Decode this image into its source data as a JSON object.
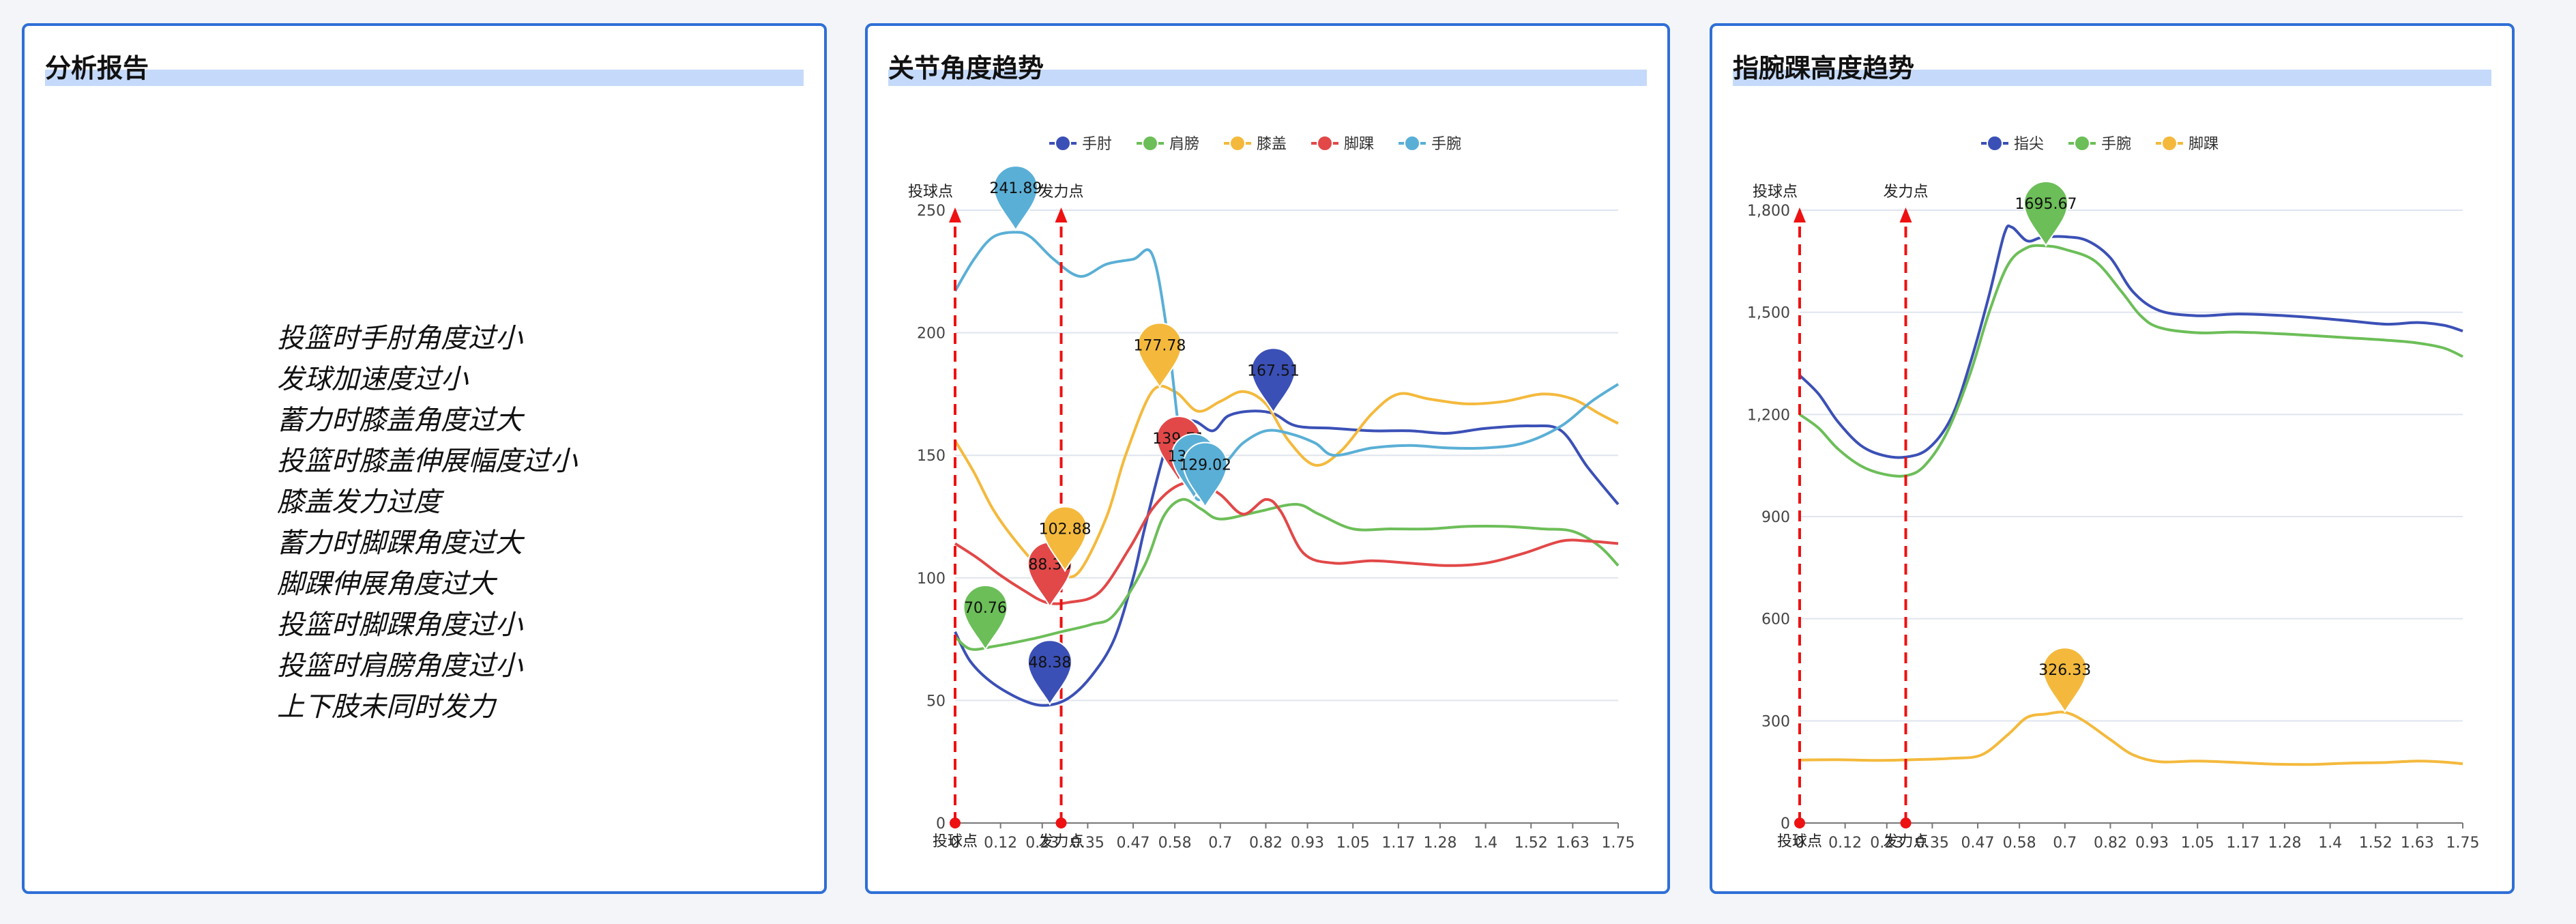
{
  "panels": {
    "report": {
      "title": "分析报告",
      "items": [
        "投篮时手肘角度过小",
        "发球加速度过小",
        "蓄力时膝盖角度过大",
        "投篮时膝盖伸展幅度过小",
        "膝盖发力过度",
        "蓄力时脚踝角度过大",
        "脚踝伸展角度过大",
        "投篮时脚踝角度过小",
        "投篮时肩膀角度过小",
        "上下肢未同时发力"
      ]
    },
    "joint": {
      "title": "关节角度趋势"
    },
    "height": {
      "title": "指腕踝高度趋势"
    }
  },
  "chart_data": [
    {
      "type": "line",
      "title": "关节角度趋势",
      "x": [
        0,
        0.12,
        0.23,
        0.35,
        0.47,
        0.58,
        0.7,
        0.82,
        0.93,
        1.05,
        1.17,
        1.28,
        1.4,
        1.52,
        1.63,
        1.75
      ],
      "x_tick_labels": [
        "0",
        "0.12",
        "0.23",
        "0.35",
        "0.47",
        "0.58",
        "0.7",
        "0.82",
        "0.93",
        "1.05",
        "1.17",
        "1.28",
        "1.4",
        "1.52",
        "1.63",
        "1.75"
      ],
      "xlim": [
        0,
        1.75
      ],
      "ylim": [
        0,
        250
      ],
      "y_ticks": [
        0,
        50,
        100,
        150,
        200,
        250
      ],
      "y_tick_labels": [
        "0",
        "50",
        "100",
        "150",
        "200",
        "250"
      ],
      "legend": "top-center",
      "grid": true,
      "series": [
        {
          "name": "手肘",
          "color": "#3b50b6",
          "points": [
            [
              0,
              78
            ],
            [
              0.04,
              66
            ],
            [
              0.1,
              57
            ],
            [
              0.18,
              50
            ],
            [
              0.24,
              48
            ],
            [
              0.3,
              51
            ],
            [
              0.36,
              60
            ],
            [
              0.42,
              75
            ],
            [
              0.47,
              100
            ],
            [
              0.5,
              120
            ],
            [
              0.55,
              150
            ],
            [
              0.58,
              162
            ],
            [
              0.63,
              164
            ],
            [
              0.68,
              160
            ],
            [
              0.72,
              166
            ],
            [
              0.78,
              168
            ],
            [
              0.84,
              167
            ],
            [
              0.9,
              162
            ],
            [
              1.0,
              161
            ],
            [
              1.1,
              160
            ],
            [
              1.2,
              160
            ],
            [
              1.3,
              159
            ],
            [
              1.4,
              161
            ],
            [
              1.52,
              162
            ],
            [
              1.6,
              160
            ],
            [
              1.67,
              145
            ],
            [
              1.75,
              130
            ]
          ]
        },
        {
          "name": "肩膀",
          "color": "#6cbe58",
          "points": [
            [
              0,
              76
            ],
            [
              0.04,
              71
            ],
            [
              0.1,
              72
            ],
            [
              0.2,
              75
            ],
            [
              0.28,
              78
            ],
            [
              0.36,
              81
            ],
            [
              0.42,
              85
            ],
            [
              0.5,
              105
            ],
            [
              0.55,
              125
            ],
            [
              0.6,
              132
            ],
            [
              0.65,
              128
            ],
            [
              0.7,
              124
            ],
            [
              0.8,
              127
            ],
            [
              0.9,
              130
            ],
            [
              0.96,
              126
            ],
            [
              1.05,
              120
            ],
            [
              1.15,
              120
            ],
            [
              1.25,
              120
            ],
            [
              1.35,
              121
            ],
            [
              1.45,
              121
            ],
            [
              1.55,
              120
            ],
            [
              1.63,
              119
            ],
            [
              1.7,
              113
            ],
            [
              1.75,
              105
            ]
          ]
        },
        {
          "name": "膝盖",
          "color": "#f4b93c",
          "points": [
            [
              0,
              156
            ],
            [
              0.05,
              143
            ],
            [
              0.1,
              128
            ],
            [
              0.16,
              115
            ],
            [
              0.22,
              105
            ],
            [
              0.28,
              101
            ],
            [
              0.33,
              103
            ],
            [
              0.4,
              125
            ],
            [
              0.45,
              150
            ],
            [
              0.52,
              176
            ],
            [
              0.58,
              176
            ],
            [
              0.64,
              168
            ],
            [
              0.7,
              172
            ],
            [
              0.76,
              176
            ],
            [
              0.82,
              171
            ],
            [
              0.88,
              156
            ],
            [
              0.95,
              146
            ],
            [
              1.02,
              152
            ],
            [
              1.1,
              167
            ],
            [
              1.17,
              175
            ],
            [
              1.25,
              173
            ],
            [
              1.35,
              171
            ],
            [
              1.45,
              172
            ],
            [
              1.55,
              175
            ],
            [
              1.63,
              173
            ],
            [
              1.7,
              167
            ],
            [
              1.75,
              163
            ]
          ]
        },
        {
          "name": "脚踝",
          "color": "#e24848",
          "points": [
            [
              0,
              114
            ],
            [
              0.06,
              108
            ],
            [
              0.12,
              101
            ],
            [
              0.18,
              95
            ],
            [
              0.24,
              90
            ],
            [
              0.3,
              90
            ],
            [
              0.38,
              94
            ],
            [
              0.46,
              112
            ],
            [
              0.52,
              128
            ],
            [
              0.58,
              137
            ],
            [
              0.64,
              139
            ],
            [
              0.7,
              134
            ],
            [
              0.76,
              126
            ],
            [
              0.82,
              132
            ],
            [
              0.86,
              127
            ],
            [
              0.92,
              110
            ],
            [
              1.0,
              106
            ],
            [
              1.1,
              107
            ],
            [
              1.2,
              106
            ],
            [
              1.3,
              105
            ],
            [
              1.4,
              106
            ],
            [
              1.5,
              110
            ],
            [
              1.6,
              115
            ],
            [
              1.67,
              115
            ],
            [
              1.75,
              114
            ]
          ]
        },
        {
          "name": "手腕",
          "color": "#5aafd6",
          "points": [
            [
              0,
              217
            ],
            [
              0.05,
              230
            ],
            [
              0.1,
              239
            ],
            [
              0.16,
              241
            ],
            [
              0.2,
              239
            ],
            [
              0.26,
              230
            ],
            [
              0.33,
              223
            ],
            [
              0.4,
              228
            ],
            [
              0.47,
              230
            ],
            [
              0.52,
              232
            ],
            [
              0.56,
              200
            ],
            [
              0.6,
              150
            ],
            [
              0.64,
              132
            ],
            [
              0.68,
              142
            ],
            [
              0.72,
              148
            ],
            [
              0.76,
              155
            ],
            [
              0.82,
              160
            ],
            [
              0.88,
              159
            ],
            [
              0.95,
              155
            ],
            [
              1.0,
              150
            ],
            [
              1.1,
              153
            ],
            [
              1.2,
              154
            ],
            [
              1.3,
              153
            ],
            [
              1.4,
              153
            ],
            [
              1.5,
              155
            ],
            [
              1.6,
              162
            ],
            [
              1.68,
              172
            ],
            [
              1.75,
              179
            ]
          ]
        }
      ],
      "pins": [
        {
          "series": 4,
          "x": 0.16,
          "y": 241.89,
          "label": "241.89"
        },
        {
          "series": 1,
          "x": 0.08,
          "y": 70.76,
          "label": "70.76"
        },
        {
          "series": 3,
          "x": 0.25,
          "y": 88.36,
          "label": "88.36"
        },
        {
          "series": 0,
          "x": 0.25,
          "y": 48.38,
          "label": "48.38"
        },
        {
          "series": 2,
          "x": 0.29,
          "y": 102.88,
          "label": "102.88"
        },
        {
          "series": 2,
          "x": 0.54,
          "y": 177.78,
          "label": "177.78"
        },
        {
          "series": 0,
          "x": 0.84,
          "y": 167.51,
          "label": "167.51"
        },
        {
          "series": 3,
          "x": 0.59,
          "y": 139.71,
          "label": "139.71"
        },
        {
          "series": 4,
          "x": 0.63,
          "y": 132.55,
          "label": "132.55"
        },
        {
          "series": 4,
          "x": 0.66,
          "y": 129.02,
          "label": "129.02"
        }
      ],
      "markers": [
        {
          "x": 0,
          "label": "投球点"
        },
        {
          "x": 0.28,
          "label": "发力点"
        }
      ]
    },
    {
      "type": "line",
      "title": "指腕踝高度趋势",
      "x": [
        0,
        0.12,
        0.23,
        0.35,
        0.47,
        0.58,
        0.7,
        0.82,
        0.93,
        1.05,
        1.17,
        1.28,
        1.4,
        1.52,
        1.63,
        1.75
      ],
      "x_tick_labels": [
        "0",
        "0.12",
        "0.23",
        "0.35",
        "0.47",
        "0.58",
        "0.7",
        "0.82",
        "0.93",
        "1.05",
        "1.17",
        "1.28",
        "1.4",
        "1.52",
        "1.63",
        "1.75"
      ],
      "xlim": [
        0,
        1.75
      ],
      "ylim": [
        0,
        1800
      ],
      "y_ticks": [
        0,
        300,
        600,
        900,
        1200,
        1500,
        1800
      ],
      "y_tick_labels": [
        "0",
        "300",
        "600",
        "900",
        "1,200",
        "1,500",
        "1,800"
      ],
      "legend": "top-center",
      "grid": true,
      "series": [
        {
          "name": "指尖",
          "color": "#3b50b6",
          "points": [
            [
              0,
              1315
            ],
            [
              0.05,
              1260
            ],
            [
              0.1,
              1180
            ],
            [
              0.16,
              1110
            ],
            [
              0.22,
              1080
            ],
            [
              0.28,
              1075
            ],
            [
              0.34,
              1100
            ],
            [
              0.4,
              1190
            ],
            [
              0.45,
              1350
            ],
            [
              0.5,
              1550
            ],
            [
              0.54,
              1730
            ],
            [
              0.56,
              1750
            ],
            [
              0.6,
              1710
            ],
            [
              0.64,
              1720
            ],
            [
              0.7,
              1722
            ],
            [
              0.76,
              1710
            ],
            [
              0.82,
              1660
            ],
            [
              0.88,
              1560
            ],
            [
              0.95,
              1505
            ],
            [
              1.05,
              1490
            ],
            [
              1.15,
              1495
            ],
            [
              1.25,
              1492
            ],
            [
              1.35,
              1485
            ],
            [
              1.45,
              1475
            ],
            [
              1.55,
              1465
            ],
            [
              1.63,
              1470
            ],
            [
              1.7,
              1462
            ],
            [
              1.75,
              1445
            ]
          ]
        },
        {
          "name": "手腕",
          "color": "#6cbe58",
          "points": [
            [
              0,
              1200
            ],
            [
              0.05,
              1160
            ],
            [
              0.1,
              1100
            ],
            [
              0.16,
              1050
            ],
            [
              0.22,
              1025
            ],
            [
              0.28,
              1020
            ],
            [
              0.33,
              1050
            ],
            [
              0.39,
              1150
            ],
            [
              0.45,
              1320
            ],
            [
              0.5,
              1500
            ],
            [
              0.55,
              1640
            ],
            [
              0.6,
              1690
            ],
            [
              0.65,
              1695
            ],
            [
              0.7,
              1685
            ],
            [
              0.78,
              1650
            ],
            [
              0.85,
              1560
            ],
            [
              0.9,
              1490
            ],
            [
              0.95,
              1455
            ],
            [
              1.05,
              1440
            ],
            [
              1.15,
              1442
            ],
            [
              1.25,
              1438
            ],
            [
              1.35,
              1432
            ],
            [
              1.45,
              1425
            ],
            [
              1.55,
              1418
            ],
            [
              1.63,
              1410
            ],
            [
              1.7,
              1395
            ],
            [
              1.75,
              1370
            ]
          ]
        },
        {
          "name": "脚踝",
          "color": "#f4b93c",
          "points": [
            [
              0,
              185
            ],
            [
              0.1,
              186
            ],
            [
              0.2,
              184
            ],
            [
              0.3,
              186
            ],
            [
              0.4,
              190
            ],
            [
              0.48,
              200
            ],
            [
              0.55,
              260
            ],
            [
              0.6,
              310
            ],
            [
              0.65,
              320
            ],
            [
              0.7,
              325
            ],
            [
              0.75,
              300
            ],
            [
              0.82,
              245
            ],
            [
              0.88,
              200
            ],
            [
              0.95,
              180
            ],
            [
              1.05,
              182
            ],
            [
              1.15,
              178
            ],
            [
              1.25,
              173
            ],
            [
              1.35,
              172
            ],
            [
              1.45,
              176
            ],
            [
              1.55,
              178
            ],
            [
              1.63,
              182
            ],
            [
              1.7,
              179
            ],
            [
              1.75,
              174
            ]
          ]
        }
      ],
      "pins": [
        {
          "series": 1,
          "x": 0.65,
          "y": 1695.67,
          "label": "1695.67"
        },
        {
          "series": 2,
          "x": 0.7,
          "y": 326.33,
          "label": "326.33"
        }
      ],
      "markers": [
        {
          "x": 0,
          "label": "投球点"
        },
        {
          "x": 0.28,
          "label": "发力点"
        }
      ]
    }
  ]
}
